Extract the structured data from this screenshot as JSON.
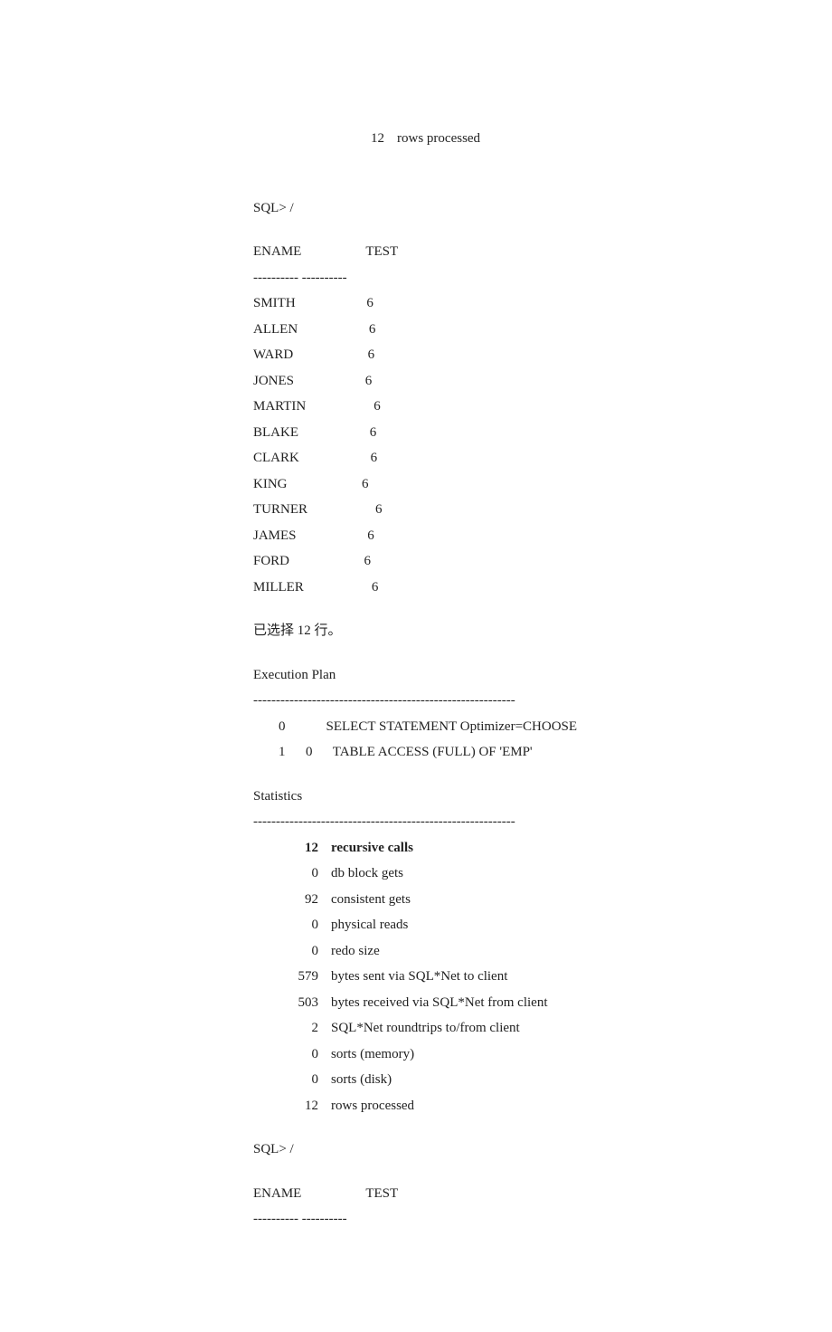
{
  "top_stat": {
    "num": "12",
    "label": "rows processed"
  },
  "prompt1": "SQL> /",
  "table1": {
    "header_ename": "ENAME",
    "header_test": "TEST",
    "separator": "---------- ----------",
    "rows": [
      {
        "ename": "SMITH",
        "test": "6"
      },
      {
        "ename": "ALLEN",
        "test": "6"
      },
      {
        "ename": "WARD",
        "test": "6"
      },
      {
        "ename": "JONES",
        "test": "6"
      },
      {
        "ename": "MARTIN",
        "test": "6"
      },
      {
        "ename": "BLAKE",
        "test": "6"
      },
      {
        "ename": "CLARK",
        "test": "6"
      },
      {
        "ename": "KING",
        "test": "6"
      },
      {
        "ename": "TURNER",
        "test": "6"
      },
      {
        "ename": "JAMES",
        "test": "6"
      },
      {
        "ename": "FORD",
        "test": "6"
      },
      {
        "ename": "MILLER",
        "test": "6"
      }
    ]
  },
  "rows_selected": "已选择 12 行。",
  "exec_plan_title": "Execution Plan",
  "exec_plan_sep": "----------------------------------------------------------",
  "exec_plan": {
    "line1_c1": "0",
    "line1_c2": "",
    "line1_text": "SELECT STATEMENT Optimizer=CHOOSE",
    "line2_c1": "1",
    "line2_c2": "0",
    "line2_text": "TABLE ACCESS (FULL) OF 'EMP'"
  },
  "stats_title": "Statistics",
  "stats_sep": "----------------------------------------------------------",
  "stats": [
    {
      "num": "12",
      "label": "recursive calls",
      "bold": true
    },
    {
      "num": "0",
      "label": "db block gets"
    },
    {
      "num": "92",
      "label": "consistent gets"
    },
    {
      "num": "0",
      "label": "physical reads"
    },
    {
      "num": "0",
      "label": "redo size"
    },
    {
      "num": "579",
      "label": "bytes sent via SQL*Net to client"
    },
    {
      "num": "503",
      "label": "bytes received via SQL*Net from client"
    },
    {
      "num": "2",
      "label": "SQL*Net roundtrips to/from client"
    },
    {
      "num": "0",
      "label": "sorts (memory)"
    },
    {
      "num": "0",
      "label": "sorts (disk)"
    },
    {
      "num": "12",
      "label": "rows processed"
    }
  ],
  "prompt2": "SQL> /",
  "table2": {
    "header_ename": "ENAME",
    "header_test": "TEST",
    "separator": "---------- ----------"
  }
}
